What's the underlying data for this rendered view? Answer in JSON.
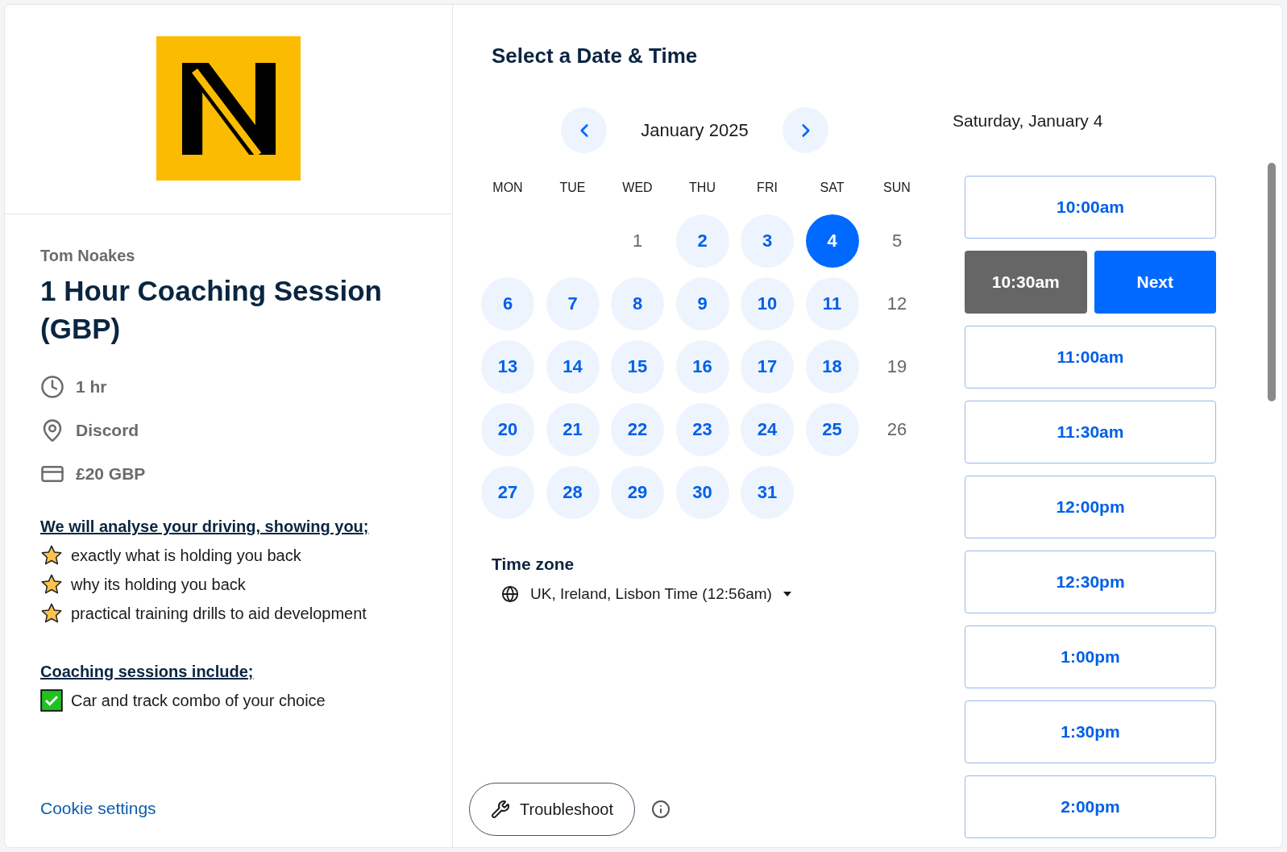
{
  "organizer": "Tom Noakes",
  "event_title": "1 Hour Coaching Session (GBP)",
  "details": [
    {
      "kind": "duration",
      "text": "1 hr"
    },
    {
      "kind": "location",
      "text": "Discord"
    },
    {
      "kind": "price",
      "text": "£20 GBP"
    }
  ],
  "description": [
    {
      "kind": "heading",
      "text": "We will analyse your driving, showing you;"
    },
    {
      "kind": "star",
      "text": "exactly what is holding you back"
    },
    {
      "kind": "star",
      "text": "why its holding you back"
    },
    {
      "kind": "star",
      "text": "practical training drills to aid development"
    },
    {
      "kind": "spacer"
    },
    {
      "kind": "heading",
      "text": "Coaching sessions include;"
    },
    {
      "kind": "check",
      "text": "Car and track combo of your choice"
    }
  ],
  "cookie_link": "Cookie settings",
  "picker_title": "Select a Date & Time",
  "month": "January 2025",
  "weekdays": [
    "MON",
    "TUE",
    "WED",
    "THU",
    "FRI",
    "SAT",
    "SUN"
  ],
  "weeks": [
    [
      {
        "kind": "blank"
      },
      {
        "kind": "blank"
      },
      {
        "kind": "day",
        "label": "1",
        "available": false,
        "selected": false
      },
      {
        "kind": "day",
        "label": "2",
        "available": true,
        "selected": false
      },
      {
        "kind": "day",
        "label": "3",
        "available": true,
        "selected": false
      },
      {
        "kind": "day",
        "label": "4",
        "available": true,
        "selected": true
      },
      {
        "kind": "day",
        "label": "5",
        "available": false,
        "selected": false
      }
    ],
    [
      {
        "kind": "day",
        "label": "6",
        "available": true,
        "selected": false
      },
      {
        "kind": "day",
        "label": "7",
        "available": true,
        "selected": false
      },
      {
        "kind": "day",
        "label": "8",
        "available": true,
        "selected": false
      },
      {
        "kind": "day",
        "label": "9",
        "available": true,
        "selected": false
      },
      {
        "kind": "day",
        "label": "10",
        "available": true,
        "selected": false
      },
      {
        "kind": "day",
        "label": "11",
        "available": true,
        "selected": false
      },
      {
        "kind": "day",
        "label": "12",
        "available": false,
        "selected": false
      }
    ],
    [
      {
        "kind": "day",
        "label": "13",
        "available": true,
        "selected": false
      },
      {
        "kind": "day",
        "label": "14",
        "available": true,
        "selected": false
      },
      {
        "kind": "day",
        "label": "15",
        "available": true,
        "selected": false
      },
      {
        "kind": "day",
        "label": "16",
        "available": true,
        "selected": false
      },
      {
        "kind": "day",
        "label": "17",
        "available": true,
        "selected": false
      },
      {
        "kind": "day",
        "label": "18",
        "available": true,
        "selected": false
      },
      {
        "kind": "day",
        "label": "19",
        "available": false,
        "selected": false
      }
    ],
    [
      {
        "kind": "day",
        "label": "20",
        "available": true,
        "selected": false
      },
      {
        "kind": "day",
        "label": "21",
        "available": true,
        "selected": false
      },
      {
        "kind": "day",
        "label": "22",
        "available": true,
        "selected": false
      },
      {
        "kind": "day",
        "label": "23",
        "available": true,
        "selected": false
      },
      {
        "kind": "day",
        "label": "24",
        "available": true,
        "selected": false
      },
      {
        "kind": "day",
        "label": "25",
        "available": true,
        "selected": false
      },
      {
        "kind": "day",
        "label": "26",
        "available": false,
        "selected": false
      }
    ],
    [
      {
        "kind": "day",
        "label": "27",
        "available": true,
        "selected": false
      },
      {
        "kind": "day",
        "label": "28",
        "available": true,
        "selected": false
      },
      {
        "kind": "day",
        "label": "29",
        "available": true,
        "selected": false
      },
      {
        "kind": "day",
        "label": "30",
        "available": true,
        "selected": false
      },
      {
        "kind": "day",
        "label": "31",
        "available": true,
        "selected": false
      }
    ]
  ],
  "time_zone": {
    "label": "Time zone",
    "value": "UK, Ireland, Lisbon Time (12:56am)"
  },
  "troubleshoot": "Troubleshoot",
  "selected_date": "Saturday, January 4",
  "next_button": "Next",
  "slots": [
    {
      "time": "10:00am",
      "selected": false
    },
    {
      "time": "10:30am",
      "selected": true
    },
    {
      "time": "11:00am",
      "selected": false
    },
    {
      "time": "11:30am",
      "selected": false
    },
    {
      "time": "12:00pm",
      "selected": false
    },
    {
      "time": "12:30pm",
      "selected": false
    },
    {
      "time": "1:00pm",
      "selected": false
    },
    {
      "time": "1:30pm",
      "selected": false
    },
    {
      "time": "2:00pm",
      "selected": false
    }
  ]
}
